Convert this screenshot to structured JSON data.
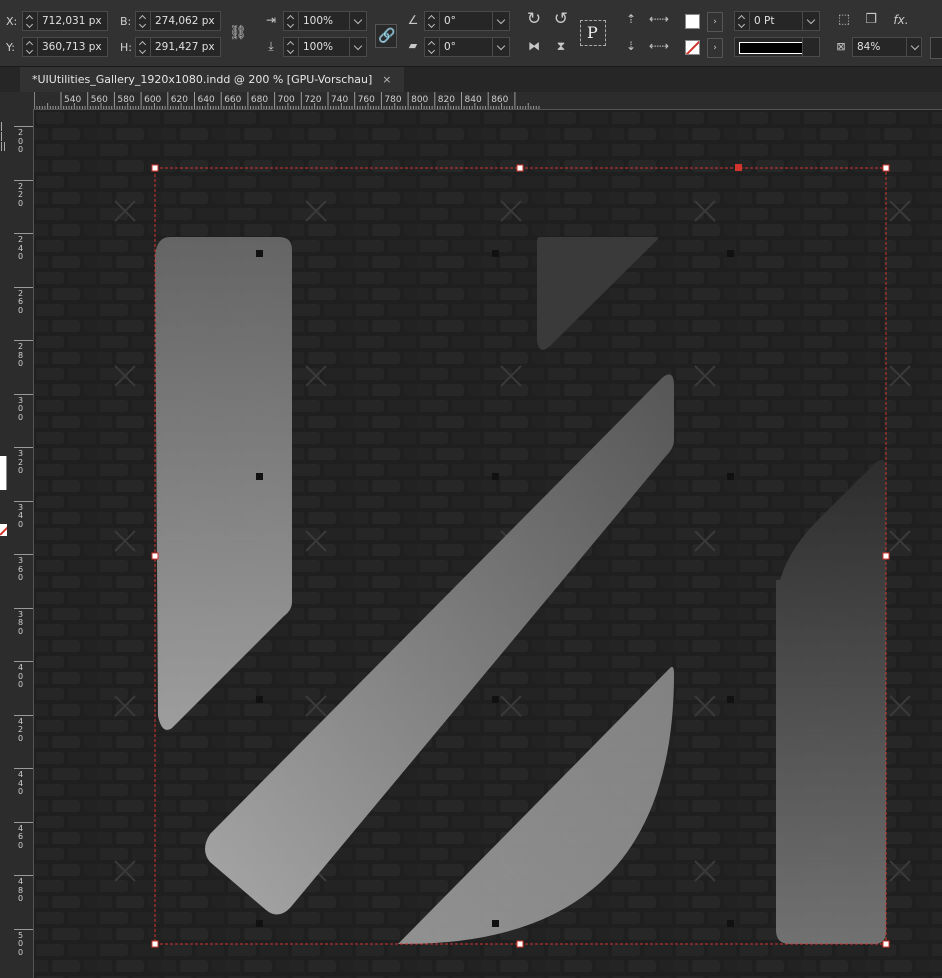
{
  "control_panel": {
    "x_label": "X:",
    "x_value": "712,031 px",
    "y_label": "Y:",
    "y_value": "360,713 px",
    "w_label": "B:",
    "w_value": "274,062 px",
    "h_label": "H:",
    "h_value": "291,427 px",
    "scale_x": "100%",
    "scale_y": "100%",
    "rotation": "0°",
    "shear": "0°",
    "stroke_weight": "0 Pt",
    "opacity": "84%",
    "fx_label": "fx.",
    "paragraph_glyph": "P"
  },
  "document_tab": {
    "title": "*UIUtilities_Gallery_1920x1080.indd @ 200 % [GPU-Vorschau]",
    "close": "×"
  },
  "ruler_h": {
    "ticks": [
      "540",
      "560",
      "580",
      "600",
      "620",
      "640",
      "660",
      "680",
      "700",
      "720",
      "740",
      "760",
      "780",
      "800",
      "820",
      "840",
      "860"
    ]
  },
  "ruler_v": {
    "labels": [
      "2\n0\n0",
      "2\n2\n0",
      "2\n4\n0",
      "2\n6\n0",
      "2\n8\n0",
      "3\n0\n0",
      "3\n2\n0",
      "3\n4\n0",
      "3\n6\n0",
      "3\n8\n0",
      "4\n0\n0",
      "4\n2\n0",
      "4\n4\n0",
      "4\n6\n0",
      "4\n8\n0",
      "5\n0\n0"
    ]
  },
  "colors": {
    "accent": "#d0342c",
    "panel": "#323232",
    "canvas": "#202020"
  },
  "icons": {
    "rotate_cw": "rotate-cw-icon",
    "rotate_ccw": "rotate-ccw-icon",
    "flip_h": "flip-horizontal-icon",
    "flip_v": "flip-vertical-icon",
    "constrain": "chain-link-icon",
    "effects": "fx-icon"
  }
}
